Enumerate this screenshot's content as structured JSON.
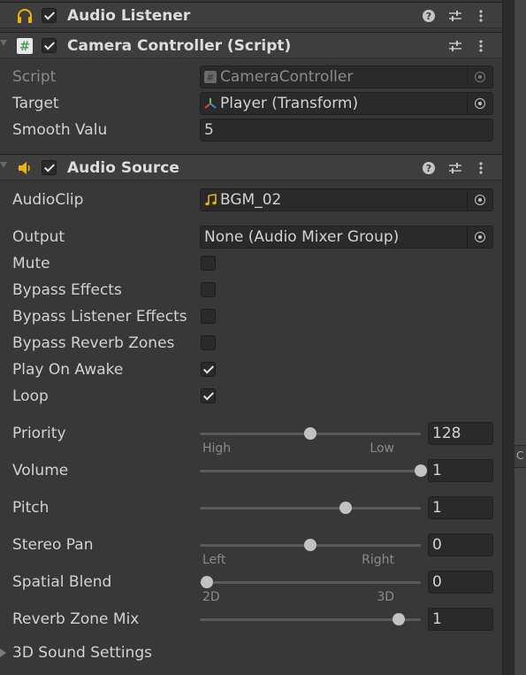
{
  "components": {
    "audio_listener": {
      "title": "Audio Listener",
      "enabled": true
    },
    "camera_controller": {
      "title": "Camera Controller (Script)",
      "enabled": true,
      "script_label": "Script",
      "script_value": "CameraController",
      "target_label": "Target",
      "target_value": "Player (Transform)",
      "smooth_label": "Smooth Valu",
      "smooth_value": "5"
    },
    "audio_source": {
      "title": "Audio Source",
      "enabled": true,
      "audioclip_label": "AudioClip",
      "audioclip_value": "BGM_02",
      "output_label": "Output",
      "output_value": "None (Audio Mixer Group)",
      "toggles": [
        {
          "label": "Mute",
          "checked": false
        },
        {
          "label": "Bypass Effects",
          "checked": false
        },
        {
          "label": "Bypass Listener Effects",
          "checked": false
        },
        {
          "label": "Bypass Reverb Zones",
          "checked": false
        },
        {
          "label": "Play On Awake",
          "checked": true
        },
        {
          "label": "Loop",
          "checked": true
        }
      ],
      "sliders": {
        "priority": {
          "label": "Priority",
          "value": "128",
          "fraction": 0.5,
          "min_label": "High",
          "max_label": "Low"
        },
        "volume": {
          "label": "Volume",
          "value": "1",
          "fraction": 1.0
        },
        "pitch": {
          "label": "Pitch",
          "value": "1",
          "fraction": 0.66
        },
        "stereo_pan": {
          "label": "Stereo Pan",
          "value": "0",
          "fraction": 0.5,
          "min_label": "Left",
          "max_label": "Right"
        },
        "spatial_blend": {
          "label": "Spatial Blend",
          "value": "0",
          "fraction": 0.03,
          "min_label": "2D",
          "max_label": "3D"
        },
        "reverb_zone_mix": {
          "label": "Reverb Zone Mix",
          "value": "1",
          "fraction": 0.9
        }
      },
      "sound_settings_label": "3D Sound Settings"
    }
  },
  "colors": {
    "accent_audio": "#f0b400",
    "script_icon": "#3aa655",
    "transform_x": "#e0463c",
    "transform_y": "#76c043",
    "transform_z": "#3a8de0"
  },
  "icons": [
    "headphones-icon",
    "script-icon",
    "speaker-icon",
    "help-icon",
    "settings-sliders-icon",
    "more-vert-icon",
    "object-picker-icon",
    "transform-icon",
    "audio-clip-icon"
  ]
}
